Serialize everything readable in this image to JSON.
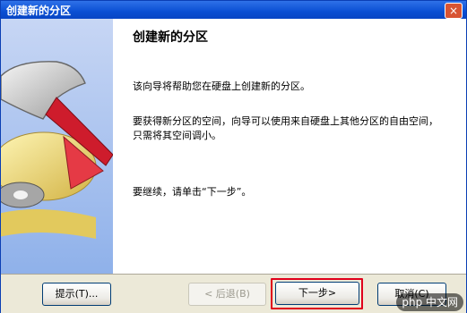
{
  "window": {
    "title": "创建新的分区",
    "close_glyph": "×"
  },
  "content": {
    "heading": "创建新的分区",
    "p1": "该向导将帮助您在硬盘上创建新的分区。",
    "p2": "要获得新分区的空间，向导可以使用来自硬盘上其他分区的自由空间，只需将其空间调小。",
    "p3": "要继续，请单击“下一步”。"
  },
  "buttons": {
    "tips": "提示(T)...",
    "back": "< 后退(B)",
    "next": "下一步>",
    "cancel": "取消(C)"
  },
  "watermark": "php 中文网"
}
